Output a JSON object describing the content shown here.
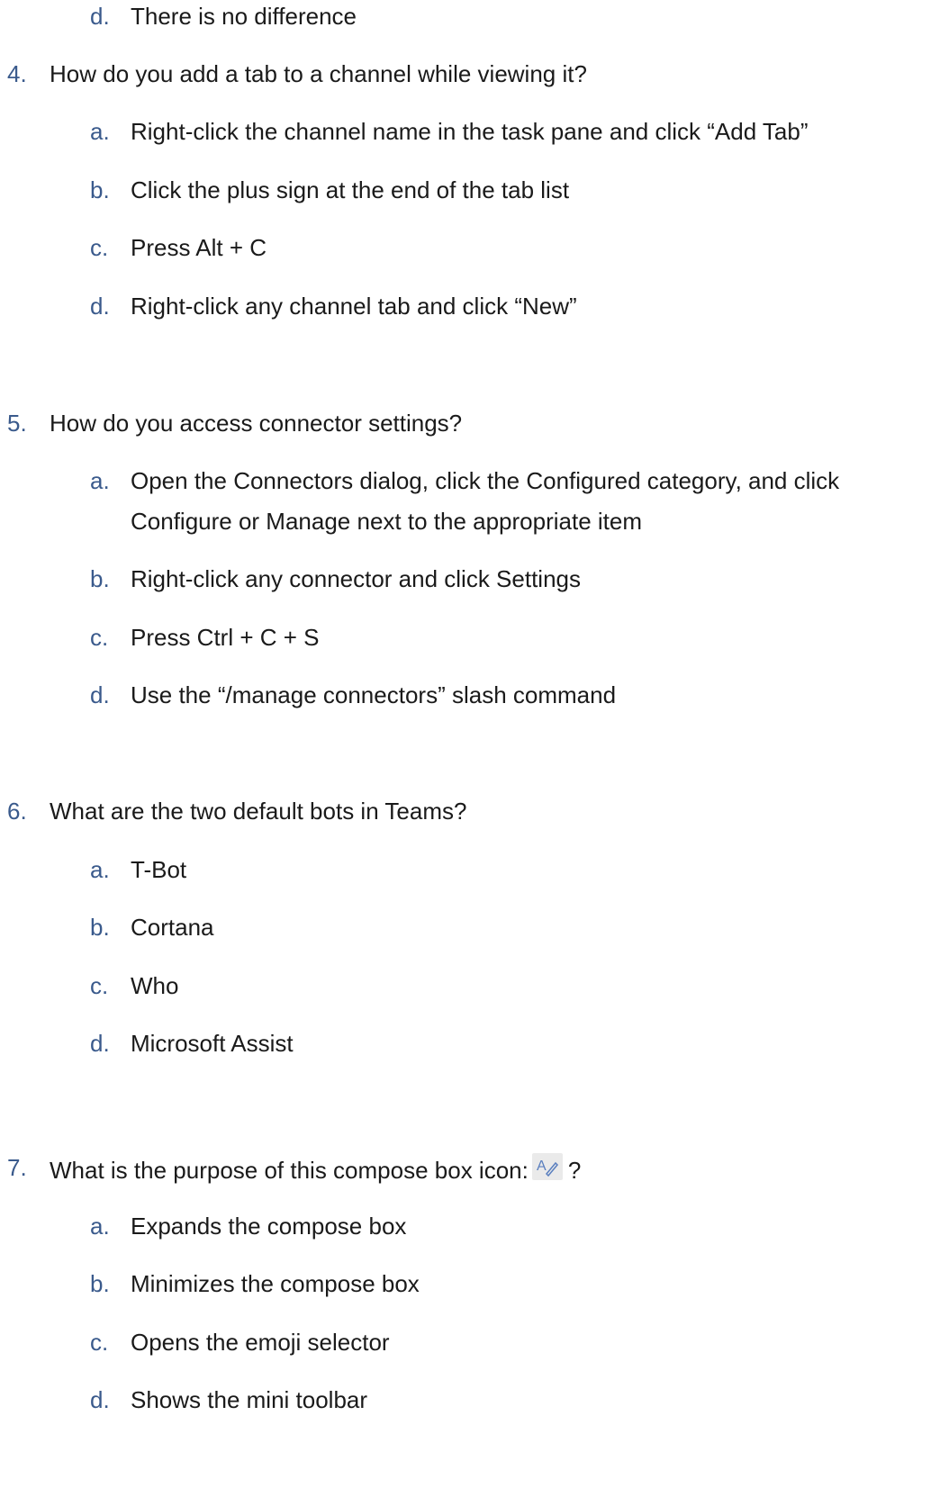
{
  "q3": {
    "options": [
      {
        "letter": "d.",
        "text": "There is no difference"
      }
    ]
  },
  "q4": {
    "number": "4.",
    "text": "How do you add a tab to a channel while viewing it?",
    "options": [
      {
        "letter": "a.",
        "text": "Right-click the channel name in the task pane and click “Add Tab”"
      },
      {
        "letter": "b.",
        "text": "Click the plus sign at the end of the tab list"
      },
      {
        "letter": "c.",
        "text": "Press Alt + C"
      },
      {
        "letter": "d.",
        "text": "Right-click any channel tab and click “New”"
      }
    ]
  },
  "q5": {
    "number": "5.",
    "text": "How do you access connector settings?",
    "options": [
      {
        "letter": "a.",
        "text": "Open the Connectors dialog, click the Configured category, and click",
        "text2": "Configure or Manage next to the appropriate item"
      },
      {
        "letter": "b.",
        "text": "Right-click any connector and click Settings"
      },
      {
        "letter": "c.",
        "text": "Press Ctrl + C + S"
      },
      {
        "letter": "d.",
        "text": "Use the “/manage connectors” slash command"
      }
    ]
  },
  "q6": {
    "number": "6.",
    "text": "What are the two default bots in Teams?",
    "options": [
      {
        "letter": "a.",
        "text": "T-Bot"
      },
      {
        "letter": "b.",
        "text": "Cortana"
      },
      {
        "letter": "c.",
        "text": "Who"
      },
      {
        "letter": "d.",
        "text": "Microsoft Assist"
      }
    ]
  },
  "q7": {
    "number": "7.",
    "text": "What is the purpose of this compose box icon:",
    "text_after": "?",
    "icon": "format-text-icon",
    "options": [
      {
        "letter": "a.",
        "text": "Expands the compose box"
      },
      {
        "letter": "b.",
        "text": "Minimizes the compose box"
      },
      {
        "letter": "c.",
        "text": "Opens the emoji selector"
      },
      {
        "letter": "d.",
        "text": "Shows the mini toolbar"
      }
    ]
  },
  "colors": {
    "numbering": "#3a5a8c",
    "text": "#1a1a1a",
    "icon_bg": "#eaeaea",
    "icon_stroke": "#5a7fbf"
  }
}
